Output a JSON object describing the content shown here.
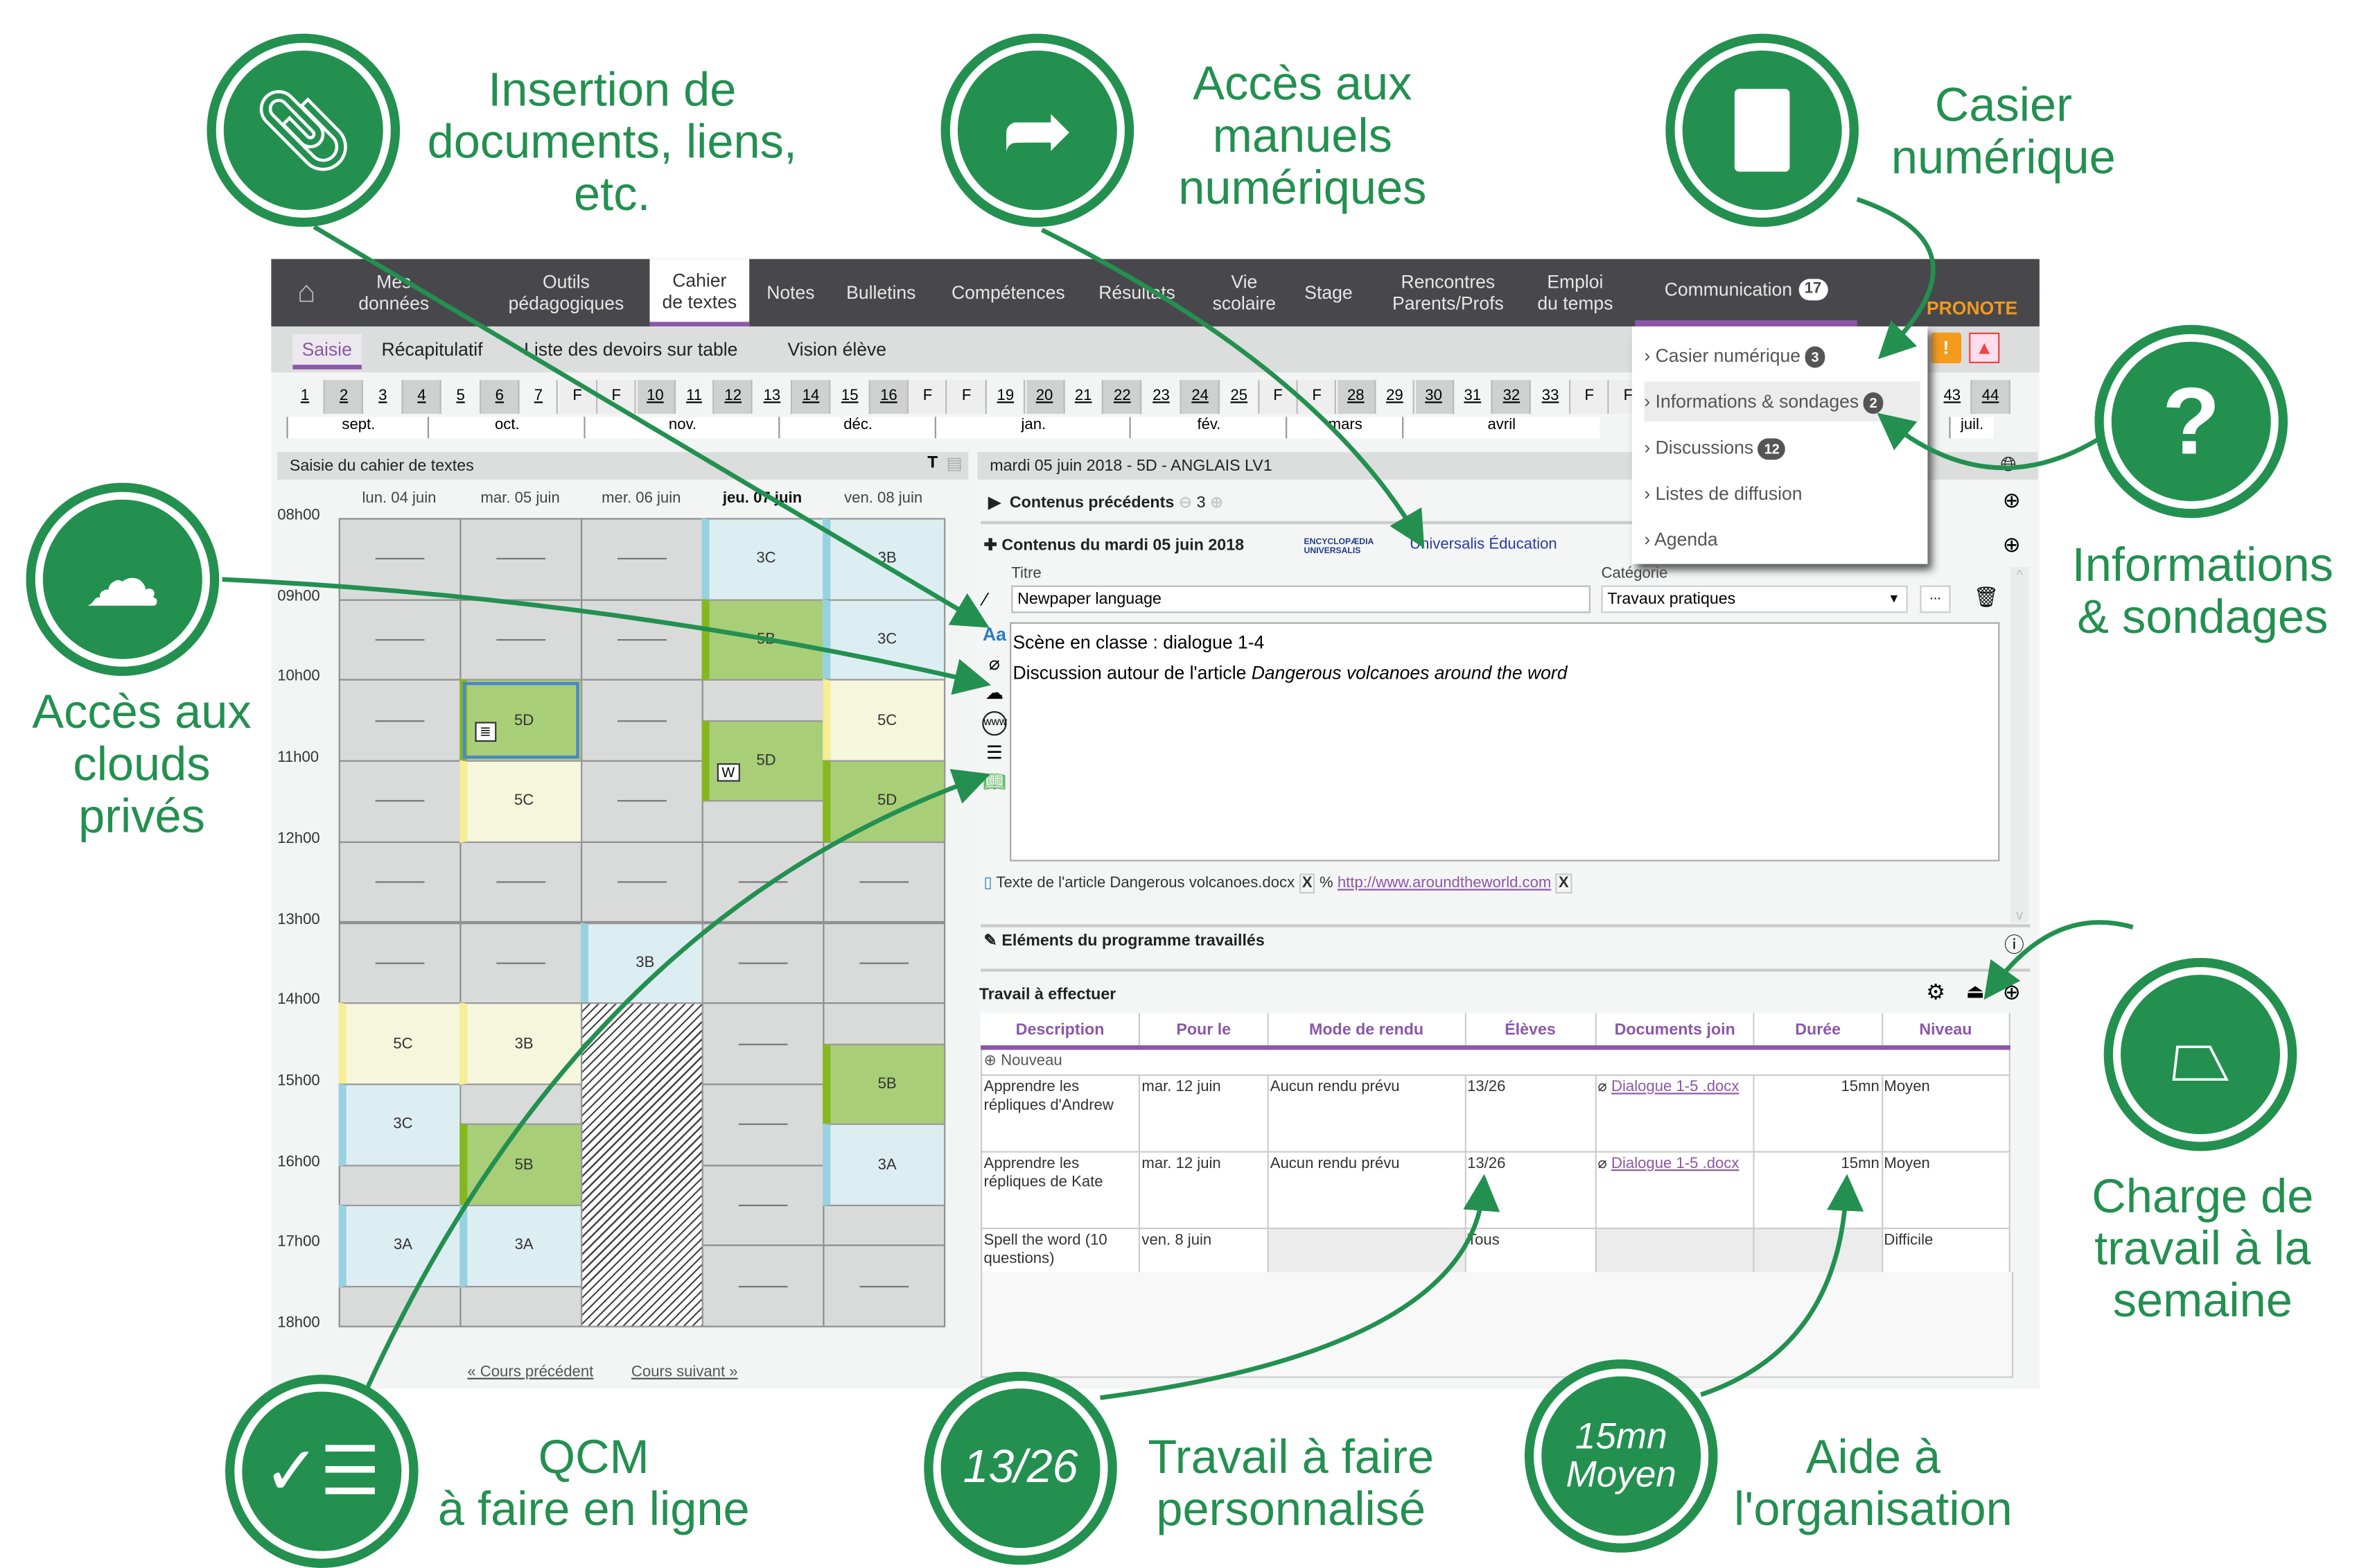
{
  "nav": {
    "items": [
      {
        "label": "Mes données"
      },
      {
        "label": "Outils\npédagogiques"
      },
      {
        "label": "Cahier\nde textes",
        "active": true
      },
      {
        "label": "Notes"
      },
      {
        "label": "Bulletins"
      },
      {
        "label": "Compétences"
      },
      {
        "label": "Résultats"
      },
      {
        "label": "Vie\nscolaire"
      },
      {
        "label": "Stage"
      },
      {
        "label": "Rencontres\nParents/Profs"
      },
      {
        "label": "Emploi\ndu temps"
      }
    ],
    "communication": {
      "label": "Communication",
      "count": "17"
    },
    "logo": "PRONOTE"
  },
  "subtabs": [
    "Saisie",
    "Récapitulatif",
    "Liste des devoirs sur table",
    "Vision élève"
  ],
  "weeks": [
    "1",
    "2",
    "3",
    "4",
    "5",
    "6",
    "7",
    "F",
    "F",
    "10",
    "11",
    "12",
    "13",
    "14",
    "15",
    "16",
    "F",
    "F",
    "19",
    "20",
    "21",
    "22",
    "23",
    "24",
    "25",
    "F",
    "F",
    "28",
    "29",
    "30",
    "31",
    "32",
    "33",
    "F",
    "F"
  ],
  "weeks_right": [
    "43",
    "44"
  ],
  "months": [
    "sept.",
    "oct.",
    "nov.",
    "déc.",
    "jan.",
    "fév.",
    "mars",
    "avril",
    "juil."
  ],
  "dropdown": [
    {
      "label": "Casier numérique",
      "count": "3"
    },
    {
      "label": "Informations & sondages",
      "count": "2",
      "highlighted": true
    },
    {
      "label": "Discussions",
      "count": "12"
    },
    {
      "label": "Listes de diffusion"
    },
    {
      "label": "Agenda"
    }
  ],
  "left_panel": {
    "title": "Saisie du cahier de textes",
    "days": [
      "lun. 04 juin",
      "mar. 05 juin",
      "mer. 06 juin",
      "jeu. 07 juin",
      "ven. 08 juin"
    ],
    "current_day_index": 3,
    "hours": [
      "08h00",
      "09h00",
      "10h00",
      "11h00",
      "12h00",
      "13h00",
      "14h00",
      "15h00",
      "16h00",
      "17h00",
      "18h00"
    ],
    "courses": [
      {
        "day": 0,
        "start": 14,
        "end": 15,
        "label": "5C",
        "type": "yellow"
      },
      {
        "day": 0,
        "start": 15,
        "end": 16,
        "label": "3C",
        "type": "blue"
      },
      {
        "day": 0,
        "start": 16.5,
        "end": 17.5,
        "label": "3A",
        "type": "blue"
      },
      {
        "day": 1,
        "start": 10,
        "end": 11,
        "label": "5D",
        "type": "green",
        "selected": true,
        "icon": "qcm-icon"
      },
      {
        "day": 1,
        "start": 11,
        "end": 12,
        "label": "5C",
        "type": "yellow"
      },
      {
        "day": 1,
        "start": 14,
        "end": 15,
        "label": "3B",
        "type": "yellow"
      },
      {
        "day": 1,
        "start": 15.5,
        "end": 16.5,
        "label": "5B",
        "type": "green"
      },
      {
        "day": 1,
        "start": 16.5,
        "end": 17.5,
        "label": "3A",
        "type": "blue"
      },
      {
        "day": 2,
        "start": 13,
        "end": 14,
        "label": "3B",
        "type": "blue"
      },
      {
        "day": 2,
        "start": 14,
        "end": 18,
        "label": "",
        "type": "hatched"
      },
      {
        "day": 3,
        "start": 8,
        "end": 9,
        "label": "3C",
        "type": "blue"
      },
      {
        "day": 3,
        "start": 9,
        "end": 10,
        "label": "5B",
        "type": "green"
      },
      {
        "day": 3,
        "start": 10.5,
        "end": 11.5,
        "label": "5D",
        "type": "green",
        "icon": "word-icon"
      },
      {
        "day": 4,
        "start": 8,
        "end": 9,
        "label": "3B",
        "type": "blue"
      },
      {
        "day": 4,
        "start": 9,
        "end": 10,
        "label": "3C",
        "type": "blue"
      },
      {
        "day": 4,
        "start": 10,
        "end": 11,
        "label": "5C",
        "type": "yellow"
      },
      {
        "day": 4,
        "start": 11,
        "end": 12,
        "label": "5D",
        "type": "green"
      },
      {
        "day": 4,
        "start": 14.5,
        "end": 15.5,
        "label": "5B",
        "type": "green"
      },
      {
        "day": 4,
        "start": 15.5,
        "end": 16.5,
        "label": "3A",
        "type": "blue"
      }
    ],
    "prev_link": "« Cours précédent",
    "next_link": "Cours suivant »",
    "colors": {
      "green": "#a8cf78",
      "green_bar": "#84b81e",
      "blue": "#ddeef2",
      "blue_bar": "#98d2e0",
      "yellow": "#f6f6dc",
      "yellow_bar": "#f5ee94",
      "empty": "#d9dbdb"
    }
  },
  "right_panel": {
    "title": "mardi 05 juin 2018 - 5D - ANGLAIS LV1",
    "previous_contents": {
      "label": "Contenus précédents",
      "count": "3"
    },
    "contents_header": "Contenus du mardi 05 juin 2018",
    "universalis_logo": "ENCYCLOPÆDIA UNIVERSALIS",
    "universalis_link": "Universalis Éducation",
    "title_label": "Titre",
    "title_value": "Newpaper language",
    "category_label": "Catégorie",
    "category_value": "Travaux pratiques",
    "more_button": "...",
    "body_line1": "Scène en classe : dialogue 1-4",
    "body_line2_prefix": "Discussion autour de l'article ",
    "body_line2_italic": "Dangerous volcanoes around the word",
    "attachment_file": "Texte de l'article Dangerous volcanoes.docx",
    "attachment_link": "http://www.aroundtheworld.com",
    "remove": "X",
    "program_label": "Eléments du programme travaillés",
    "work_label": "Travail à effectuer",
    "table": {
      "headers": [
        "Description",
        "Pour le",
        "Mode de rendu",
        "Élèves",
        "Documents join",
        "Durée",
        "Niveau"
      ],
      "new_label": "Nouveau",
      "rows": [
        {
          "description": "Apprendre les répliques d'Andrew",
          "due": "mar. 12 juin",
          "mode": "Aucun rendu prévu",
          "students": "13/26",
          "doc": "Dialogue 1-5 .docx",
          "duration": "15mn",
          "level": "Moyen"
        },
        {
          "description": "Apprendre les répliques de Kate",
          "due": "mar. 12 juin",
          "mode": "Aucun rendu prévu",
          "students": "13/26",
          "doc": "Dialogue 1-5 .docx",
          "duration": "15mn",
          "level": "Moyen"
        },
        {
          "description": "Spell the word (10 questions)",
          "due": "ven. 8 juin",
          "mode": "",
          "students": "Tous",
          "doc": "",
          "duration": "",
          "level": "Difficile"
        }
      ]
    }
  },
  "callouts": {
    "insertion": "Insertion de\ndocuments, liens,\netc.",
    "manuels": "Accès aux\nmanuels\nnumériques",
    "casier": "Casier\nnumérique",
    "clouds": "Accès aux\nclouds\nprivés",
    "informations": "Informations\n& sondages",
    "charge": "Charge de\ntravail à la\nsemaine",
    "qcm": "QCM\nà faire en ligne",
    "travail": "Travail à faire\npersonnalisé",
    "aide": "Aide à\nl'organisation",
    "badge_1326": "13/26",
    "badge_15mn": "15mn",
    "badge_moyen": "Moyen"
  },
  "colors": {
    "accent": "#8c57a8",
    "callout_green": "#239050",
    "nav_bg": "#48484c"
  }
}
